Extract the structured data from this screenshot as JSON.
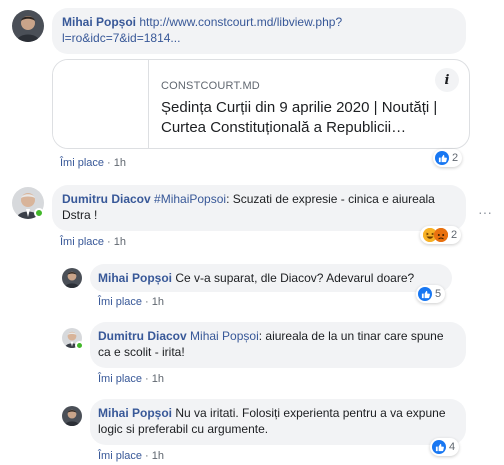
{
  "comments": [
    {
      "author": "Mihai Popșoi",
      "text_link": "http://www.constcourt.md/libview.php?l=ro&idc=7&id=1814...",
      "link_card": {
        "domain": "CONSTCOURT.MD",
        "title": "Ședința Curții din 9 aprilie 2020 | Noutăți | Curtea Constituțională a Republicii…"
      },
      "like_label": "Îmi place",
      "time": "1h",
      "reaction_count": "2"
    },
    {
      "author": "Dumitru Diacov",
      "hashtag": "#MihaiPopsoi",
      "text": ": Scuzati de expresie - cinica e aiureala Dstra !",
      "like_label": "Îmi place",
      "time": "1h",
      "reaction_count": "2",
      "more_label": "···",
      "replies": [
        {
          "author": "Mihai Popșoi",
          "text": "Ce v-a suparat, dle Diacov? Adevarul doare?",
          "like_label": "Îmi place",
          "time": "1h",
          "reaction_count": "5"
        },
        {
          "author": "Dumitru Diacov",
          "mention": "Mihai Popșoi",
          "text": ": aiureala de la un tinar care spune ca e scolit - irita!",
          "like_label": "Îmi place",
          "time": "1h"
        },
        {
          "author": "Mihai Popșoi",
          "text": "Nu va iritati. Folosiți experienta pentru a va expune logic si preferabil cu argumente.",
          "like_label": "Îmi place",
          "time": "1h",
          "reaction_count": "4"
        }
      ]
    }
  ],
  "icons": {
    "info": "i",
    "like": "like-thumb-icon",
    "haha": "haha-emoji-icon",
    "angry": "angry-emoji-icon"
  },
  "colors": {
    "name_link": "#385898",
    "bubble_bg": "#f2f3f5",
    "like_blue": "#1877f2",
    "online_green": "#42b72a"
  }
}
